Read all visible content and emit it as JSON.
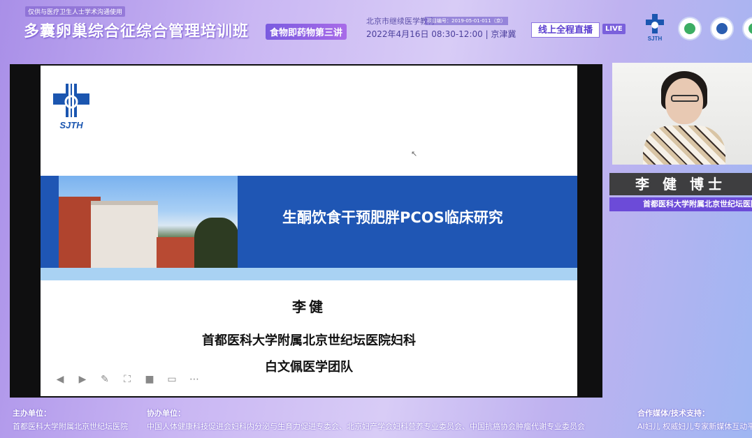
{
  "header": {
    "note": "仅供与医疗卫生人士学术沟通使用",
    "title": "多囊卵巢综合征综合管理培训班",
    "subtitle": "食物即药物第三讲",
    "organizer": "北京市继续医学教育",
    "project_code": "项目编号：2019-05-01-011（京）",
    "datetime": "2022年4月16日 08:30-12:00 | 京津冀",
    "live_button": "线上全程直播",
    "live_icon": "LIVE",
    "logo_text": "SJTH"
  },
  "slide": {
    "logo_text": "SJTH",
    "title": "生酮饮食干预肥胖PCOS临床研究",
    "presenter": "李健",
    "affiliation": "首都医科大学附属北京世纪坛医院妇科",
    "team": "白文佩医学团队",
    "toolbar": [
      "prev",
      "play",
      "pen",
      "fullscreen",
      "camera",
      "caption",
      "more"
    ]
  },
  "speaker": {
    "name": "李 健 博士",
    "affiliation": "首都医科大学附属北京世纪坛医院妇科"
  },
  "footer": {
    "host_label": "主办单位：",
    "host": "首都医科大学附属北京世纪坛医院",
    "co_label": "协办单位：",
    "co": "中国人体健康科技促进会妇科内分泌与生育力促进专委会、北京妇产学会妇科营养专业委员会、中国抗癌协会肿瘤代谢专业委员会",
    "media_label": "合作媒体/技术支持：",
    "media": "AI妇儿 权威妇儿专家新媒体互动平台"
  }
}
